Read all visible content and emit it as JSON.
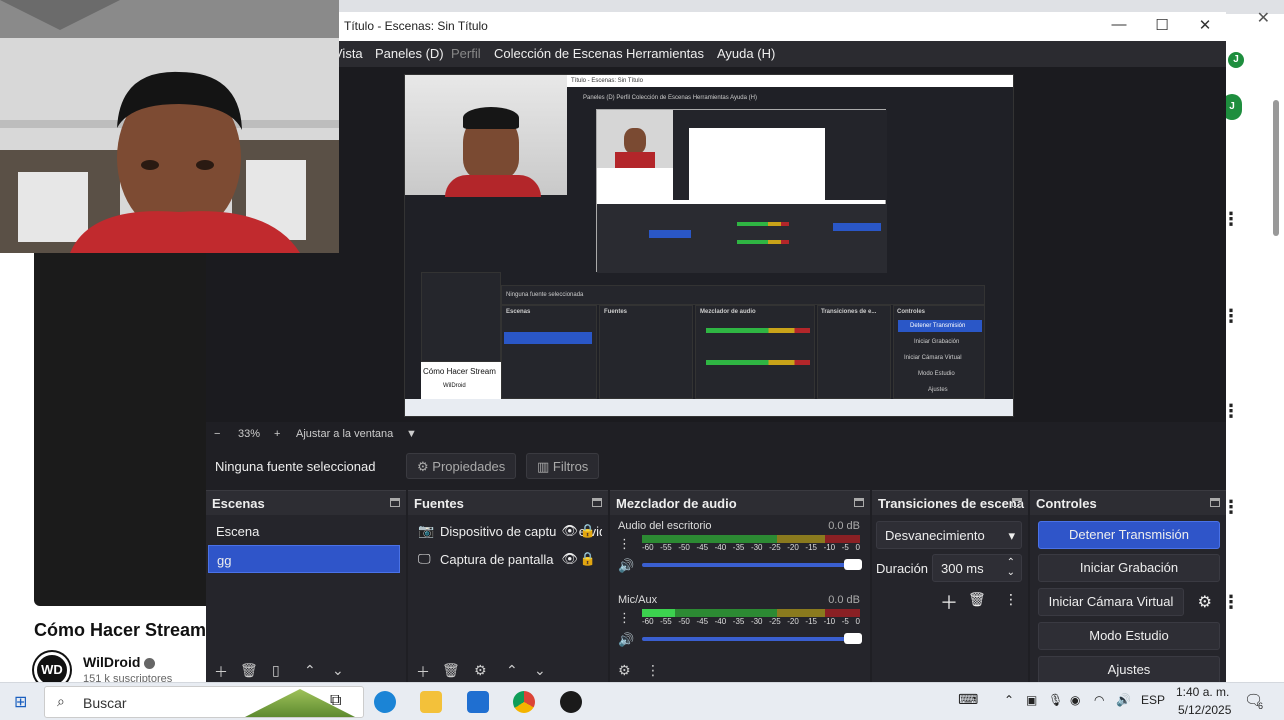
{
  "browser": {
    "close_glyph": "✕"
  },
  "youtube": {
    "video_title": "Cómo Hacer Stream",
    "channel_name": "WilDroid",
    "subscribers": "151 k suscriptores",
    "channel_logo": "WD",
    "avatar_letter": "J"
  },
  "obs": {
    "window_title": "Título - Escenas: Sin Título",
    "window_controls": {
      "minimize": "—",
      "maximize": "☐",
      "close": "✕"
    },
    "menu": [
      "Vista",
      "Paneles (D)",
      "Perfil",
      "Colección de Escenas",
      "Herramientas",
      "Ayuda (H)"
    ],
    "preview_toolbar": {
      "minus": "−",
      "zoom": "33%",
      "plus": "+",
      "fit": "Ajustar a la ventana",
      "arrow": "▼"
    },
    "source_bar": {
      "no_source": "Ninguna fuente seleccionada",
      "properties": "Propiedades",
      "filters": "Filtros"
    },
    "scenes": {
      "title": "Escenas",
      "items": [
        "Escena",
        "gg"
      ],
      "selected_index": 1
    },
    "sources": {
      "title": "Fuentes",
      "items": [
        {
          "label": "Dispositivo de captura de video",
          "icon": "camera-icon"
        },
        {
          "label": "Captura de pantalla",
          "icon": "monitor-icon"
        }
      ]
    },
    "mixer": {
      "title": "Mezclador de audio",
      "channels": [
        {
          "name": "Audio del escritorio",
          "db": "0.0 dB",
          "level": 0.0
        },
        {
          "name": "Mic/Aux",
          "db": "0.0 dB",
          "level": 0.15
        }
      ],
      "ticks": [
        "-60",
        "-55",
        "-50",
        "-45",
        "-40",
        "-35",
        "-30",
        "-25",
        "-20",
        "-15",
        "-10",
        "-5",
        "0"
      ]
    },
    "transitions": {
      "title": "Transiciones de escena",
      "selected": "Desvanecimiento",
      "duration_label": "Duración",
      "duration_value": "300 ms"
    },
    "controls": {
      "title": "Controles",
      "stop_stream": "Detener Transmisión",
      "start_recording": "Iniciar Grabación",
      "virtual_camera": "Iniciar Cámara Virtual",
      "studio_mode": "Modo Estudio",
      "settings": "Ajustes"
    },
    "nested_preview": {
      "title_text": "Título - Escenas: Sin Título",
      "menu_text": "Paneles (D)   Perfil   Colección de Escenas   Herramientas   Ayuda (H)",
      "no_source": "Ninguna fuente seleccionada",
      "scenes": "Escenas",
      "sources": "Fuentes",
      "mixer": "Mezclador de audio",
      "transitions": "Transiciones de e...",
      "controls": "Controles",
      "stop": "Detener Transmisión",
      "rec": "Iniciar Grabación",
      "vcam": "Iniciar Cámara Virtual",
      "studio": "Modo Estudio",
      "settings": "Ajustes",
      "video_title": "Cómo Hacer Stream",
      "channel": "WilDroid"
    }
  },
  "taskbar": {
    "search_placeholder": "Buscar",
    "language": "ESP",
    "time": "1:40 a. m.",
    "date": "5/12/2025",
    "notifications": "6",
    "colors": {
      "edge": "#1b84d6",
      "explorer": "#f3c13a",
      "mail": "#1f6fd1",
      "chrome": "#db4437",
      "obs": "#1a1a1a"
    }
  }
}
